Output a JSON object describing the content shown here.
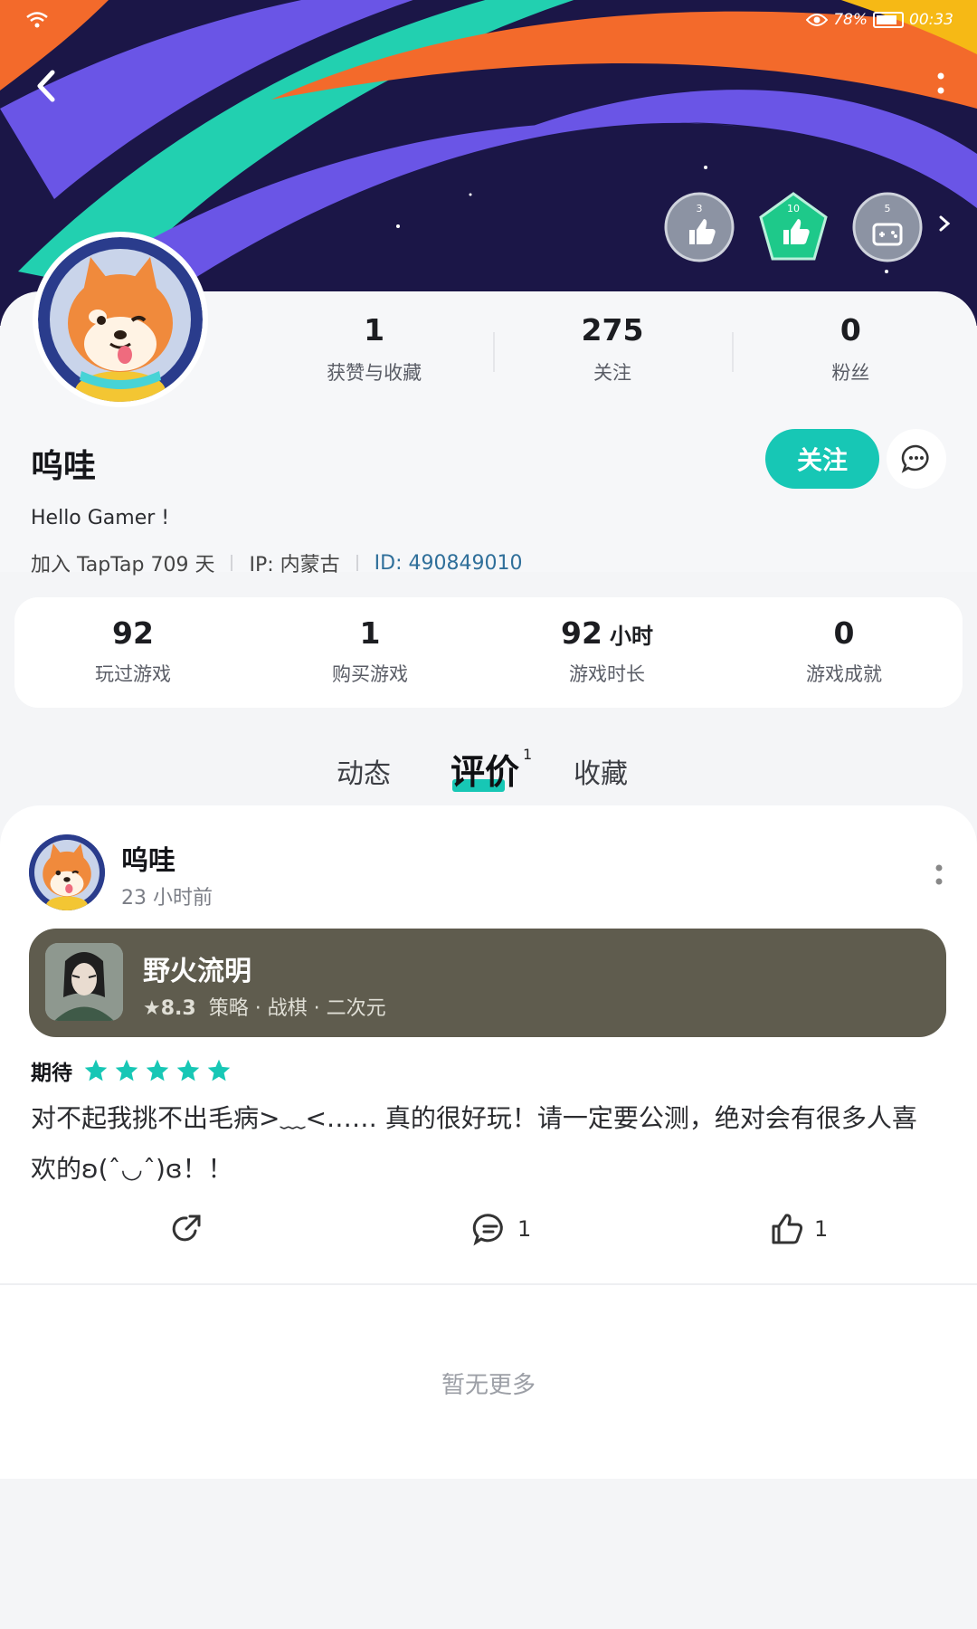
{
  "status_bar": {
    "battery_percent": "78%",
    "time": "00:33"
  },
  "badges": [
    {
      "count": "3",
      "color": "#9aa0ad",
      "icon": "thumbs-up-icon"
    },
    {
      "count": "10",
      "color": "#1ec98a",
      "icon": "thumbs-up-icon"
    },
    {
      "count": "5",
      "color": "#9aa0ad",
      "icon": "gamepad-icon"
    }
  ],
  "profile": {
    "username": "呜哇",
    "bio": "Hello Gamer !",
    "joined": "加入 TapTap 709 天",
    "ip": "IP: 内蒙古",
    "user_id": "ID: 490849010",
    "stats": [
      {
        "value": "1",
        "label": "获赞与收藏"
      },
      {
        "value": "275",
        "label": "关注"
      },
      {
        "value": "0",
        "label": "粉丝"
      }
    ],
    "follow_label": "关注"
  },
  "game_stats": [
    {
      "value": "92",
      "unit": "",
      "label": "玩过游戏"
    },
    {
      "value": "1",
      "unit": "",
      "label": "购买游戏"
    },
    {
      "value": "92",
      "unit": "小时",
      "label": "游戏时长"
    },
    {
      "value": "0",
      "unit": "",
      "label": "游戏成就"
    }
  ],
  "tabs": {
    "dynamic": "动态",
    "review": "评价",
    "review_count": "1",
    "favorites": "收藏"
  },
  "review": {
    "author": "呜哇",
    "time": "23 小时前",
    "game": {
      "title": "野火流明",
      "score": "★8.3",
      "tags": "策略 · 战棋 · 二次元"
    },
    "rating_label": "期待",
    "stars": 5,
    "text": "对不起我挑不出毛病>﹏<…… 真的很好玩！请一定要公测，绝对会有很多人喜欢的ʚ(ˆ◡ˆ)ɞ！！",
    "comments": "1",
    "likes": "1"
  },
  "footer": {
    "no_more": "暂无更多"
  },
  "colors": {
    "accent": "#17c7b5",
    "game_card": "#5f5c4e",
    "id_link": "#2f6f9a"
  }
}
